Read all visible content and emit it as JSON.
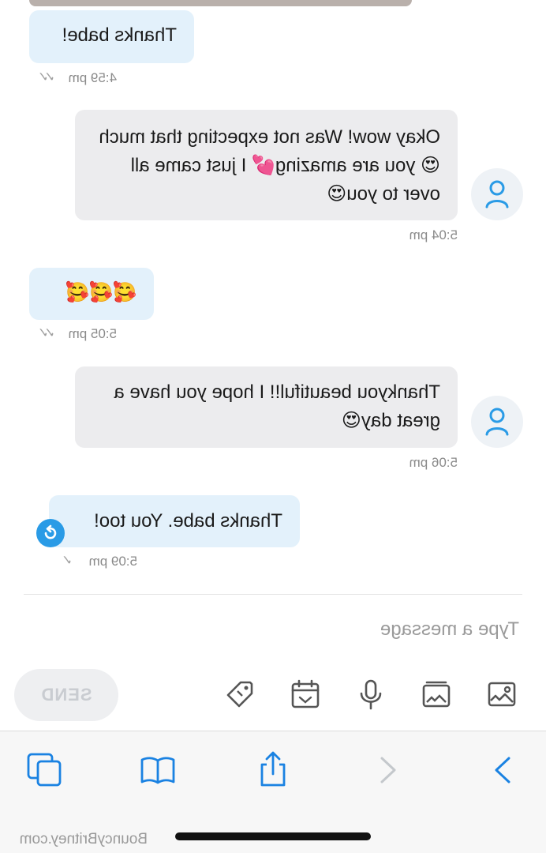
{
  "messages": [
    {
      "id": "m1",
      "direction": "outgoing",
      "text": "Thanks babe!",
      "time": "4:59 pm",
      "ticks": "✓✓"
    },
    {
      "id": "m2",
      "direction": "incoming",
      "text": "Okay wow! Was not expecting that much😍 you are amazing💕 I just came all over to you😍",
      "time": "5:04 pm"
    },
    {
      "id": "m3",
      "direction": "outgoing",
      "text": "🥰🥰🥰",
      "time": "5:05 pm",
      "ticks": "✓✓"
    },
    {
      "id": "m4",
      "direction": "incoming",
      "text": "Thankyou beautiful!! I hope you have a great day😍",
      "time": "5:06 pm"
    },
    {
      "id": "m5",
      "direction": "outgoing",
      "text": "Thanks babe. You too!",
      "time": "5:09 pm",
      "ticks": "✓"
    }
  ],
  "composer": {
    "placeholder": "Type a message",
    "send_label": "SEND",
    "tools": [
      "image-icon",
      "gallery-icon",
      "microphone-icon",
      "calendar-icon",
      "tag-icon"
    ]
  },
  "browser_bar": {
    "buttons": [
      "forward-icon",
      "back-icon",
      "share-icon",
      "bookmarks-icon",
      "tabs-icon"
    ]
  },
  "watermark": "BouncyBritney.com",
  "colors": {
    "accent": "#2a9be6",
    "outgoing_bubble": "#e3f1fb",
    "incoming_bubble": "#ececee"
  }
}
